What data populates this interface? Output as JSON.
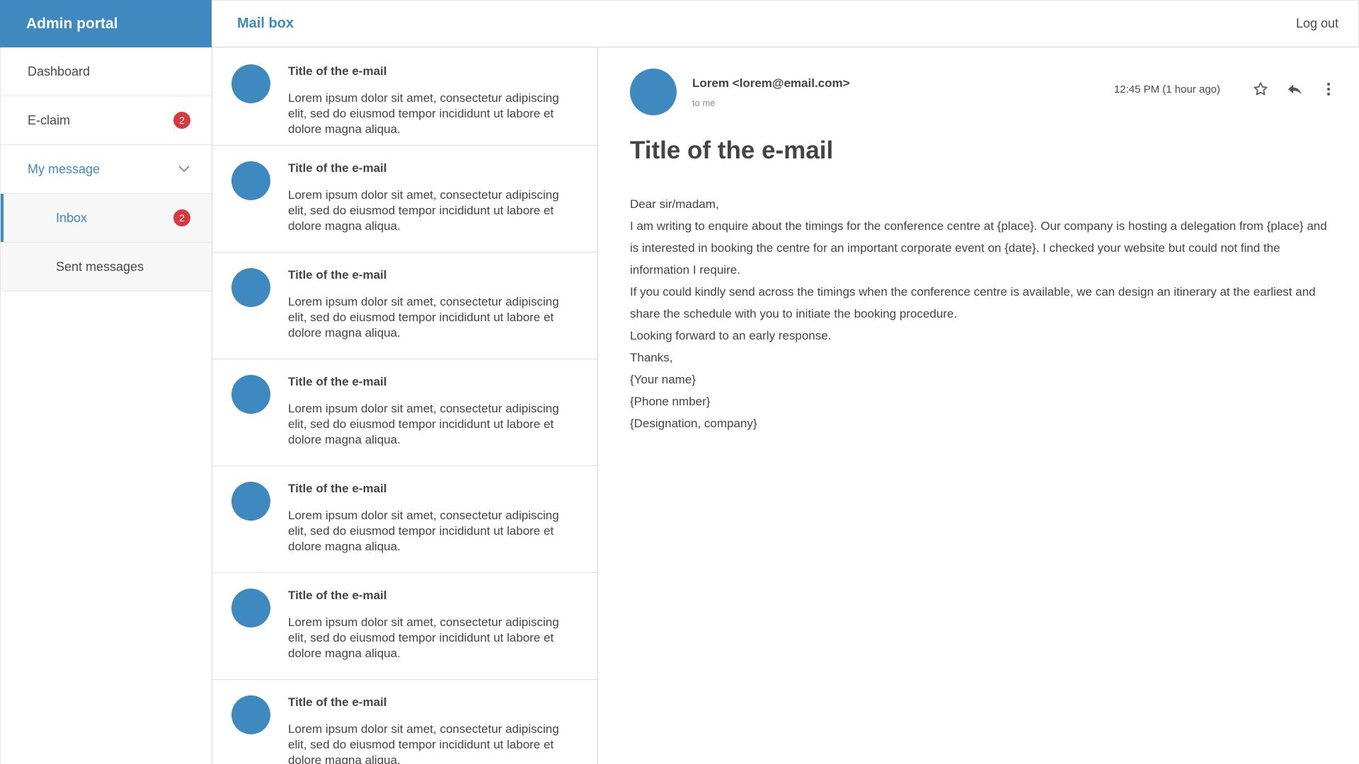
{
  "brand": {
    "title": "Admin portal"
  },
  "header": {
    "title": "Mail box",
    "logout_label": "Log out"
  },
  "sidebar": {
    "items": [
      {
        "label": "Dashboard"
      },
      {
        "label": "E-claim",
        "badge": "2"
      },
      {
        "label": "My message"
      },
      {
        "label": "Inbox",
        "badge": "2"
      },
      {
        "label": "Sent messages"
      }
    ]
  },
  "emails": [
    {
      "title": "Title of the e-mail",
      "snippet": "Lorem ipsum dolor sit amet, consectetur adipiscing elit, sed do eiusmod tempor incididunt ut labore et dolore magna aliqua."
    },
    {
      "title": "Title of the e-mail",
      "snippet": "Lorem ipsum dolor sit amet, consectetur adipiscing elit, sed do eiusmod tempor incididunt ut labore et dolore magna aliqua."
    },
    {
      "title": "Title of the e-mail",
      "snippet": "Lorem ipsum dolor sit amet, consectetur adipiscing elit, sed do eiusmod tempor incididunt ut labore et dolore magna aliqua."
    },
    {
      "title": "Title of the e-mail",
      "snippet": "Lorem ipsum dolor sit amet, consectetur adipiscing elit, sed do eiusmod tempor incididunt ut labore et dolore magna aliqua."
    },
    {
      "title": "Title of the e-mail",
      "snippet": "Lorem ipsum dolor sit amet, consectetur adipiscing elit, sed do eiusmod tempor incididunt ut labore et dolore magna aliqua."
    },
    {
      "title": "Title of the e-mail",
      "snippet": "Lorem ipsum dolor sit amet, consectetur adipiscing elit, sed do eiusmod tempor incididunt ut labore et dolore magna aliqua."
    },
    {
      "title": "Title of the e-mail",
      "snippet": "Lorem ipsum dolor sit amet, consectetur adipiscing elit, sed do eiusmod tempor incididunt ut labore et dolore magna aliqua."
    }
  ],
  "reader": {
    "sender": "Lorem <lorem@email.com>",
    "to": "to me",
    "time": "12:45 PM (1 hour ago)",
    "subject": "Title of the e-mail",
    "body": [
      "Dear sir/madam,",
      "I am writing to enquire about the timings for the conference centre at {place}. Our company is hosting a delegation from {place} and is interested in booking the centre for an important corporate event on {date}. I checked your website but could not find the information I require.",
      "If you could kindly send across the timings when the conference centre is available, we can design an itinerary at the earliest and share the schedule with you to initiate the booking procedure.",
      "Looking forward to an early response.",
      "Thanks,",
      "{Your name}",
      "{Phone nmber}",
      "{Designation, company}"
    ],
    "icons": {
      "star": "star-icon",
      "reply": "reply-icon",
      "more": "more-vertical-icon"
    }
  },
  "colors": {
    "accent": "#3e8ac0",
    "badge": "#d9383c"
  }
}
